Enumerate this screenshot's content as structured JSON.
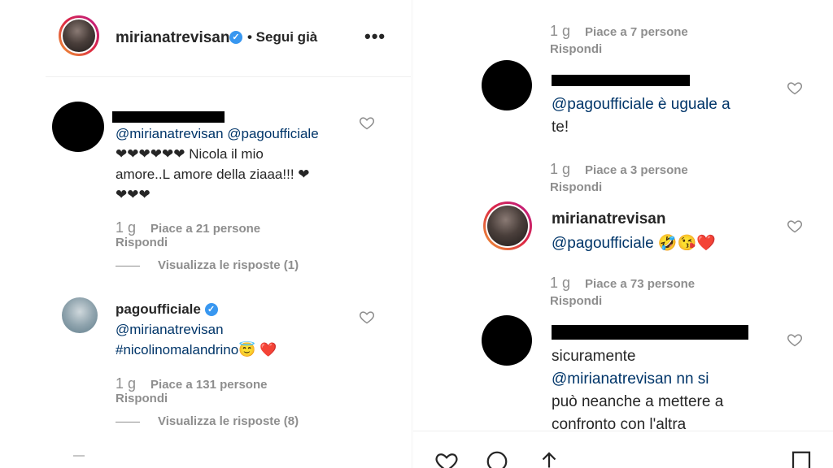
{
  "header": {
    "username": "mirianatrevisan",
    "follow_label": "• Segui già",
    "more_label": "•••"
  },
  "left": {
    "partial_top": "",
    "comments": [
      {
        "text_parts": [
          "@mirianatrevisan @pagoufficiale",
          "❤❤❤❤❤❤ Nicola il mio",
          "amore..L amore della ziaaa!!! ❤",
          "❤❤❤"
        ],
        "time": "1 g",
        "likes": "Piace a 21 persone",
        "reply": "Rispondi",
        "view_replies": "Visualizza le risposte (1)"
      },
      {
        "username": "pagoufficiale",
        "text_parts": [
          "@mirianatrevisan",
          "#nicolinomalandrino😇 ❤️"
        ],
        "time": "1 g",
        "likes": "Piace a 131 persone",
        "reply": "Rispondi",
        "view_replies": "Visualizza le risposte (8)"
      }
    ]
  },
  "right": {
    "top_meta": {
      "time": "1 g",
      "likes": "Piace a 7 persone",
      "reply": "Rispondi"
    },
    "comments": [
      {
        "text_parts": [
          "@pagoufficiale è uguale a",
          "te!"
        ],
        "time": "1 g",
        "likes": "Piace a 3 persone",
        "reply": "Rispondi"
      },
      {
        "username": "mirianatrevisan",
        "text_parts": [
          "@pagoufficiale 🤣😘❤️"
        ],
        "time": "1 g",
        "likes": "Piace a 73 persone",
        "reply": "Rispondi"
      },
      {
        "text_parts": [
          "sicuramente",
          "@mirianatrevisan nn si",
          "può neanche a mettere a",
          "confronto con l'altra"
        ]
      }
    ]
  },
  "icons": {
    "heart": "heart-outline-icon",
    "comment": "comment-bubble-icon",
    "share": "share-arrow-icon",
    "save": "bookmark-icon",
    "verified": "verified-badge-icon"
  },
  "colors": {
    "mention": "#003569",
    "muted": "#8e8e8e",
    "verified": "#3897f0"
  }
}
